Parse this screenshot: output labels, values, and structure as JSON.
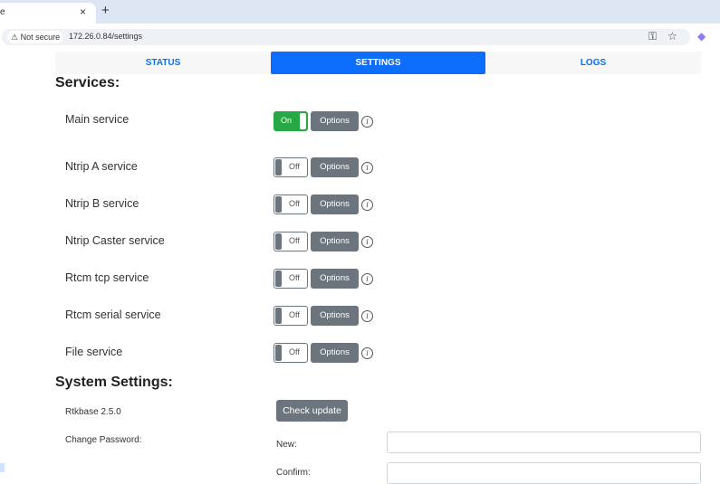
{
  "browser": {
    "tab_title": "e",
    "tab_close": "×",
    "new_tab": "+",
    "security_chip": "⚠ Not secure",
    "url": "172.26.0.84/settings",
    "icons": [
      "key-icon",
      "star-icon",
      "extension-icon"
    ]
  },
  "nav": {
    "items": [
      {
        "label": "STATUS"
      },
      {
        "label": "SETTINGS",
        "active": true
      },
      {
        "label": "LOGS"
      }
    ]
  },
  "services": {
    "heading": "Services:",
    "options_label": "Options",
    "items": [
      {
        "label": "Main service",
        "state": "On"
      },
      {
        "label": "Ntrip A service",
        "state": "Off"
      },
      {
        "label": "Ntrip B service",
        "state": "Off"
      },
      {
        "label": "Ntrip Caster service",
        "state": "Off"
      },
      {
        "label": "Rtcm tcp service",
        "state": "Off"
      },
      {
        "label": "Rtcm serial service",
        "state": "Off"
      },
      {
        "label": "File service",
        "state": "Off"
      }
    ]
  },
  "system": {
    "heading": "System Settings:",
    "version": "Rtkbase 2.5.0",
    "check_update": "Check update",
    "change_password": "Change Password:",
    "new_label": "New:",
    "confirm_label": "Confirm:",
    "new_value": "",
    "confirm_value": ""
  }
}
